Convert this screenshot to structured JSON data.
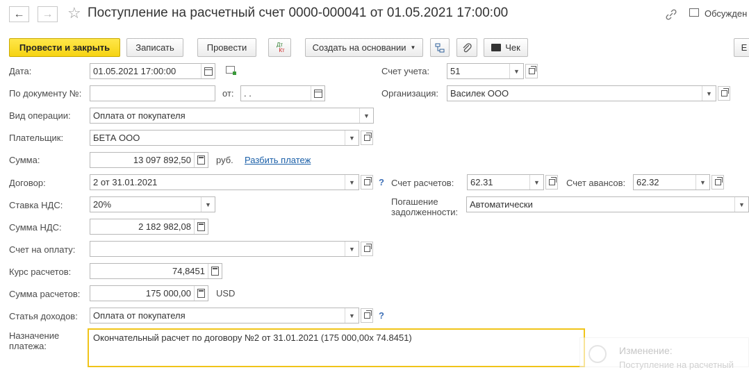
{
  "header": {
    "title": "Поступление на расчетный счет 0000-000041 от 01.05.2021 17:00:00",
    "back": "←",
    "forward": "→",
    "star": "☆",
    "discuss_label": "Обсужден"
  },
  "toolbar": {
    "post_close": "Провести и закрыть",
    "save": "Записать",
    "post": "Провести",
    "dt_kt_top": "Дт",
    "dt_kt_bottom": "Кт",
    "create_based": "Создать на основании",
    "check": "Чек",
    "more": "Е"
  },
  "form": {
    "date": {
      "label": "Дата:",
      "value": "01.05.2021 17:00:00"
    },
    "doc_number": {
      "label": "По документу №:",
      "value": "",
      "from_label": "от:",
      "from_value": " .  ."
    },
    "operation": {
      "label": "Вид операции:",
      "value": "Оплата от покупателя"
    },
    "payer": {
      "label": "Плательщик:",
      "value": "БЕТА ООО"
    },
    "amount": {
      "label": "Сумма:",
      "value": "13 097 892,50",
      "currency": "руб.",
      "split_link": "Разбить платеж"
    },
    "contract": {
      "label": "Договор:",
      "value": "2 от 31.01.2021",
      "help": "?"
    },
    "vat_rate": {
      "label": "Ставка НДС:",
      "value": "20%"
    },
    "vat_amount": {
      "label": "Сумма НДС:",
      "value": "2 182 982,08"
    },
    "invoice": {
      "label": "Счет на оплату:",
      "value": ""
    },
    "rate": {
      "label": "Курс расчетов:",
      "value": "74,8451"
    },
    "settle_amount": {
      "label": "Сумма расчетов:",
      "value": "175 000,00",
      "currency": "USD"
    },
    "income_item": {
      "label": "Статья доходов:",
      "value": "Оплата от покупателя",
      "help": "?"
    },
    "purpose": {
      "label_line1": "Назначение",
      "label_line2": "платежа:",
      "value": "Окончательный расчет по договору №2 от 31.01.2021 (175 000,00х 74.8451)"
    },
    "account": {
      "label": "Счет учета:",
      "value": "51"
    },
    "organization": {
      "label": "Организация:",
      "value": "Василек ООО"
    },
    "settle_account": {
      "label": "Счет расчетов:",
      "value": "62.31"
    },
    "advance_account": {
      "label": "Счет авансов:",
      "value": "62.32"
    },
    "debt_repayment": {
      "label_line1": "Погашение",
      "label_line2": "задолженности:",
      "value": "Автоматически"
    }
  },
  "notification": {
    "title": "Изменение:",
    "text": "Поступление на расчетный"
  },
  "colors": {
    "accent": "#f6d313",
    "link": "#1a5fa8",
    "focus_border": "#f0c419"
  }
}
